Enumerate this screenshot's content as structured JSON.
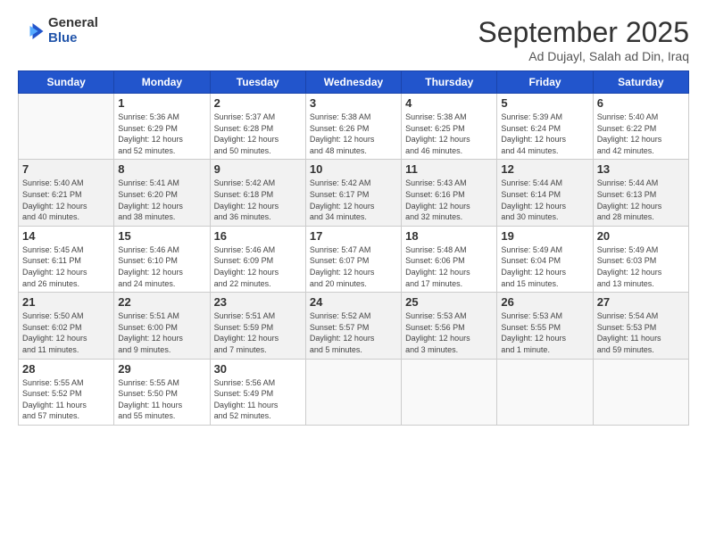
{
  "logo": {
    "general": "General",
    "blue": "Blue"
  },
  "title": "September 2025",
  "subtitle": "Ad Dujayl, Salah ad Din, Iraq",
  "weekdays": [
    "Sunday",
    "Monday",
    "Tuesday",
    "Wednesday",
    "Thursday",
    "Friday",
    "Saturday"
  ],
  "weeks": [
    [
      {
        "day": "",
        "info": ""
      },
      {
        "day": "1",
        "info": "Sunrise: 5:36 AM\nSunset: 6:29 PM\nDaylight: 12 hours\nand 52 minutes."
      },
      {
        "day": "2",
        "info": "Sunrise: 5:37 AM\nSunset: 6:28 PM\nDaylight: 12 hours\nand 50 minutes."
      },
      {
        "day": "3",
        "info": "Sunrise: 5:38 AM\nSunset: 6:26 PM\nDaylight: 12 hours\nand 48 minutes."
      },
      {
        "day": "4",
        "info": "Sunrise: 5:38 AM\nSunset: 6:25 PM\nDaylight: 12 hours\nand 46 minutes."
      },
      {
        "day": "5",
        "info": "Sunrise: 5:39 AM\nSunset: 6:24 PM\nDaylight: 12 hours\nand 44 minutes."
      },
      {
        "day": "6",
        "info": "Sunrise: 5:40 AM\nSunset: 6:22 PM\nDaylight: 12 hours\nand 42 minutes."
      }
    ],
    [
      {
        "day": "7",
        "info": "Sunrise: 5:40 AM\nSunset: 6:21 PM\nDaylight: 12 hours\nand 40 minutes."
      },
      {
        "day": "8",
        "info": "Sunrise: 5:41 AM\nSunset: 6:20 PM\nDaylight: 12 hours\nand 38 minutes."
      },
      {
        "day": "9",
        "info": "Sunrise: 5:42 AM\nSunset: 6:18 PM\nDaylight: 12 hours\nand 36 minutes."
      },
      {
        "day": "10",
        "info": "Sunrise: 5:42 AM\nSunset: 6:17 PM\nDaylight: 12 hours\nand 34 minutes."
      },
      {
        "day": "11",
        "info": "Sunrise: 5:43 AM\nSunset: 6:16 PM\nDaylight: 12 hours\nand 32 minutes."
      },
      {
        "day": "12",
        "info": "Sunrise: 5:44 AM\nSunset: 6:14 PM\nDaylight: 12 hours\nand 30 minutes."
      },
      {
        "day": "13",
        "info": "Sunrise: 5:44 AM\nSunset: 6:13 PM\nDaylight: 12 hours\nand 28 minutes."
      }
    ],
    [
      {
        "day": "14",
        "info": "Sunrise: 5:45 AM\nSunset: 6:11 PM\nDaylight: 12 hours\nand 26 minutes."
      },
      {
        "day": "15",
        "info": "Sunrise: 5:46 AM\nSunset: 6:10 PM\nDaylight: 12 hours\nand 24 minutes."
      },
      {
        "day": "16",
        "info": "Sunrise: 5:46 AM\nSunset: 6:09 PM\nDaylight: 12 hours\nand 22 minutes."
      },
      {
        "day": "17",
        "info": "Sunrise: 5:47 AM\nSunset: 6:07 PM\nDaylight: 12 hours\nand 20 minutes."
      },
      {
        "day": "18",
        "info": "Sunrise: 5:48 AM\nSunset: 6:06 PM\nDaylight: 12 hours\nand 17 minutes."
      },
      {
        "day": "19",
        "info": "Sunrise: 5:49 AM\nSunset: 6:04 PM\nDaylight: 12 hours\nand 15 minutes."
      },
      {
        "day": "20",
        "info": "Sunrise: 5:49 AM\nSunset: 6:03 PM\nDaylight: 12 hours\nand 13 minutes."
      }
    ],
    [
      {
        "day": "21",
        "info": "Sunrise: 5:50 AM\nSunset: 6:02 PM\nDaylight: 12 hours\nand 11 minutes."
      },
      {
        "day": "22",
        "info": "Sunrise: 5:51 AM\nSunset: 6:00 PM\nDaylight: 12 hours\nand 9 minutes."
      },
      {
        "day": "23",
        "info": "Sunrise: 5:51 AM\nSunset: 5:59 PM\nDaylight: 12 hours\nand 7 minutes."
      },
      {
        "day": "24",
        "info": "Sunrise: 5:52 AM\nSunset: 5:57 PM\nDaylight: 12 hours\nand 5 minutes."
      },
      {
        "day": "25",
        "info": "Sunrise: 5:53 AM\nSunset: 5:56 PM\nDaylight: 12 hours\nand 3 minutes."
      },
      {
        "day": "26",
        "info": "Sunrise: 5:53 AM\nSunset: 5:55 PM\nDaylight: 12 hours\nand 1 minute."
      },
      {
        "day": "27",
        "info": "Sunrise: 5:54 AM\nSunset: 5:53 PM\nDaylight: 11 hours\nand 59 minutes."
      }
    ],
    [
      {
        "day": "28",
        "info": "Sunrise: 5:55 AM\nSunset: 5:52 PM\nDaylight: 11 hours\nand 57 minutes."
      },
      {
        "day": "29",
        "info": "Sunrise: 5:55 AM\nSunset: 5:50 PM\nDaylight: 11 hours\nand 55 minutes."
      },
      {
        "day": "30",
        "info": "Sunrise: 5:56 AM\nSunset: 5:49 PM\nDaylight: 11 hours\nand 52 minutes."
      },
      {
        "day": "",
        "info": ""
      },
      {
        "day": "",
        "info": ""
      },
      {
        "day": "",
        "info": ""
      },
      {
        "day": "",
        "info": ""
      }
    ]
  ]
}
